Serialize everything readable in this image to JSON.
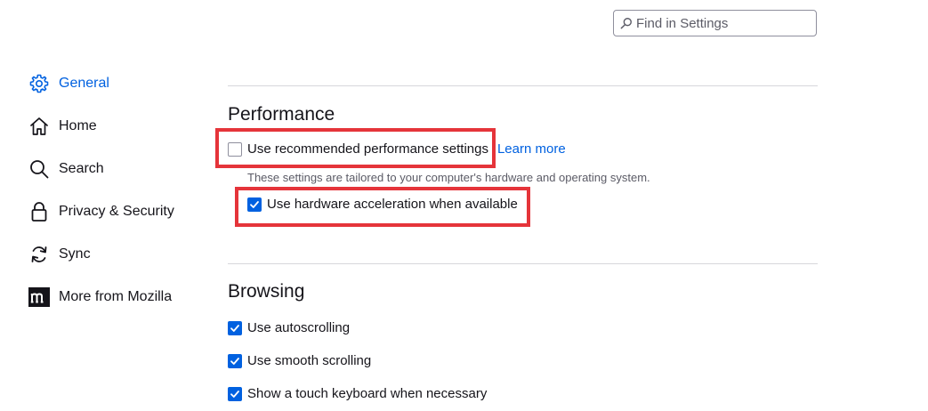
{
  "search": {
    "placeholder": "Find in Settings"
  },
  "sidebar": {
    "items": [
      {
        "label": "General",
        "icon": "gear-icon",
        "selected": true
      },
      {
        "label": "Home",
        "icon": "home-icon"
      },
      {
        "label": "Search",
        "icon": "search-icon"
      },
      {
        "label": "Privacy & Security",
        "icon": "lock-icon"
      },
      {
        "label": "Sync",
        "icon": "sync-icon"
      },
      {
        "label": "More from Mozilla",
        "icon": "mozilla-logo-icon"
      }
    ]
  },
  "performance": {
    "title": "Performance",
    "recommended": {
      "label": "Use recommended performance settings",
      "checked": false
    },
    "learn_more": "Learn more",
    "description": "These settings are tailored to your computer's hardware and operating system.",
    "hardware_accel": {
      "label": "Use hardware acceleration when available",
      "checked": true
    }
  },
  "browsing": {
    "title": "Browsing",
    "options": [
      {
        "label": "Use autoscrolling",
        "checked": true
      },
      {
        "label": "Use smooth scrolling",
        "checked": true
      },
      {
        "label": "Show a touch keyboard when necessary",
        "checked": true
      }
    ]
  },
  "colors": {
    "accent": "#0061e0",
    "highlight": "#e5343a"
  }
}
